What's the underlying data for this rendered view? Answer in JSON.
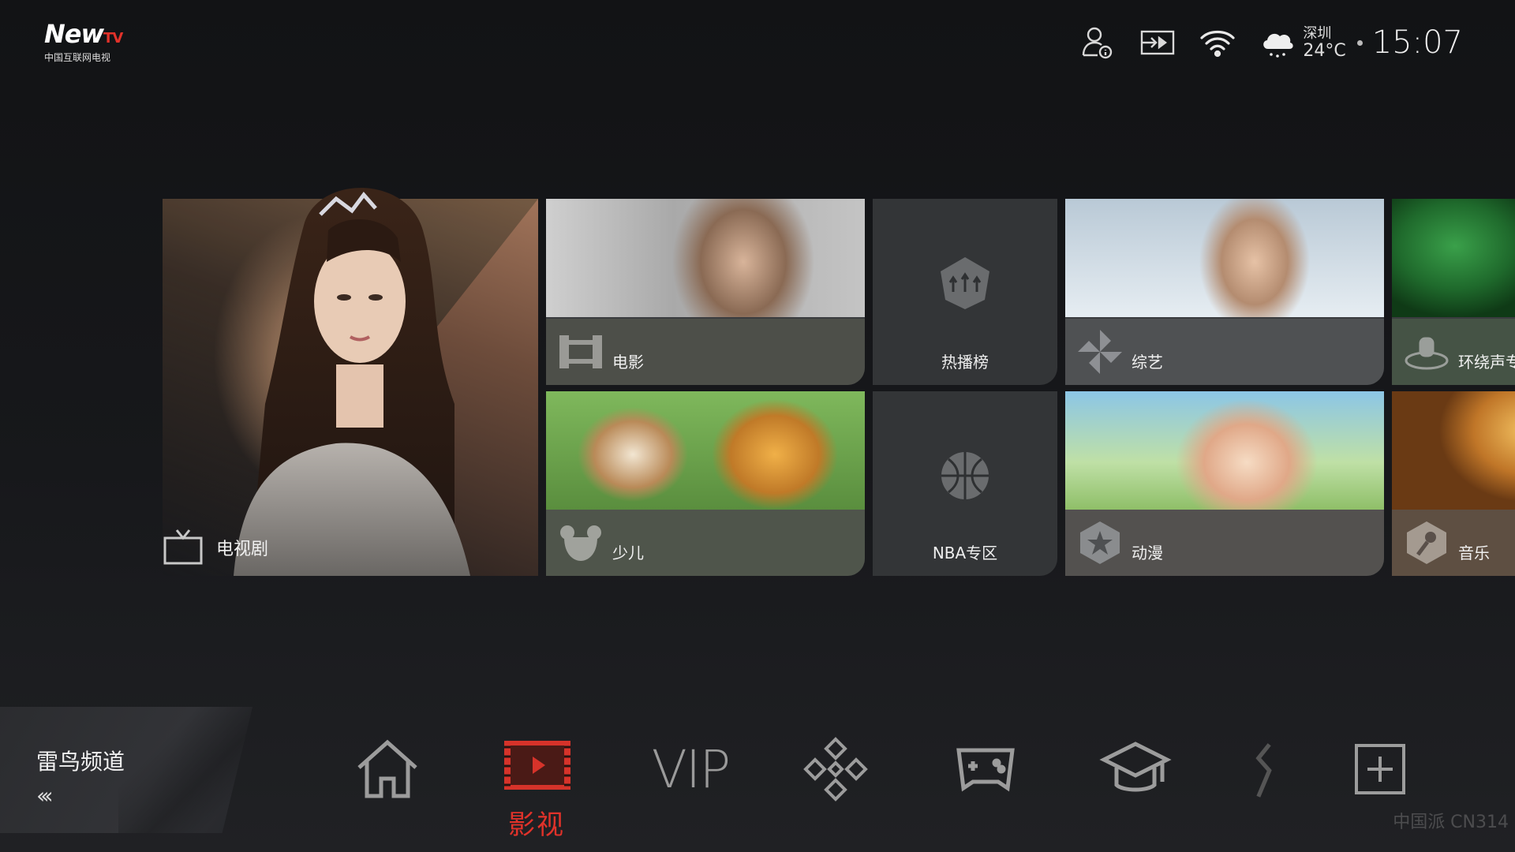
{
  "logo": {
    "brand": "New",
    "brand_suffix": "TV",
    "subtitle": "中国互联网电视"
  },
  "status": {
    "weather_city": "深圳",
    "weather_temp": "24°C",
    "time": "15:07",
    "icons": [
      "user-info-icon",
      "input-source-icon",
      "wifi-icon",
      "weather-cloud-rain-icon"
    ]
  },
  "hero": {
    "label": "电视剧",
    "icon": "tv-icon"
  },
  "tiles": {
    "movie": {
      "label": "电影",
      "icon": "film-icon"
    },
    "hot": {
      "label": "热播榜",
      "icon": "hot-rank-icon"
    },
    "variety": {
      "label": "综艺",
      "icon": "pinwheel-icon"
    },
    "surround": {
      "label": "环绕声专",
      "icon": "headphone-icon"
    },
    "kids": {
      "label": "少儿",
      "icon": "bear-icon"
    },
    "nba": {
      "label": "NBA专区",
      "icon": "basketball-icon"
    },
    "anime": {
      "label": "动漫",
      "icon": "star-icon"
    },
    "music": {
      "label": "音乐",
      "icon": "microphone-icon"
    }
  },
  "channel": {
    "title": "雷鸟频道",
    "arrow": "‹‹‹"
  },
  "dock": {
    "active_label": "影视",
    "vip_text": "VIP",
    "items": [
      "home-icon",
      "film-strip-icon",
      "vip-icon",
      "apps-icon",
      "game-controller-icon",
      "education-icon",
      "more-icon",
      "add-icon"
    ]
  },
  "watermark": "中国派 CN314",
  "colors": {
    "accent": "#e0322a",
    "tile_bar": "#464846",
    "background": "#141517"
  }
}
